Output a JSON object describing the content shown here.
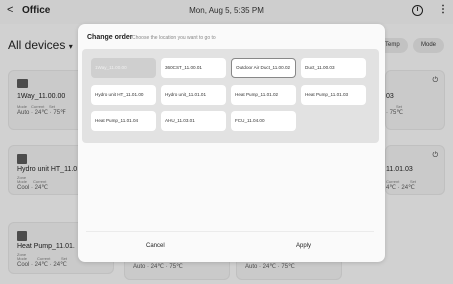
{
  "header": {
    "back_glyph": "<",
    "title": "Office",
    "datetime": "Mon, Aug 5, 5:35 PM",
    "info_glyph": "i",
    "more_glyph": "⋮"
  },
  "page": {
    "title": "All devices",
    "chevron": "▾",
    "temp_button": "Temp",
    "mode_button": "Mode"
  },
  "cards": [
    {
      "name": "1Way_11.00.00",
      "mode_label": "Mode",
      "current_label": "Current",
      "set_label": "Set",
      "values": "Auto · 24℃ · 75℉"
    },
    {
      "name": "Hydro unit HT_11.0",
      "zone_label": "Zone",
      "mode_label": "Mode",
      "current_label": "Current",
      "values": "Cool · 24℃"
    },
    {
      "name": "Heat Pump_11.01.",
      "zone_label": "Zone",
      "mode_label": "Mode",
      "current_label": "Current",
      "set_label": "Set",
      "values": "Cool · 24℃ · 24℃"
    },
    {
      "name": "11.01.03",
      "current_label": "Current",
      "set_label": "Set",
      "values": "4℃ · 24℃"
    },
    {
      "name": "03",
      "set_label": "Set",
      "values": "· 75℃"
    },
    {
      "values": "Auto · 24℃ · 75℃"
    },
    {
      "values": "Auto · 24℃ · 75℃"
    }
  ],
  "dialog": {
    "title": "Change order",
    "hint": "Choose the location you want to go to",
    "options": [
      {
        "label": "1Way_11.00.00",
        "state": "disabled"
      },
      {
        "label": "360CST_11.00.01",
        "state": "normal"
      },
      {
        "label": "Outdoor Air Duct_11.00.02",
        "state": "selected"
      },
      {
        "label": "Duct_11.00.03",
        "state": "normal"
      },
      {
        "label": "Hydro unit HT_11.01.00",
        "state": "normal"
      },
      {
        "label": "Hydro unit_11.01.01",
        "state": "normal"
      },
      {
        "label": "Heat Pump_11.01.02",
        "state": "normal"
      },
      {
        "label": "Heat Pump_11.01.03",
        "state": "normal"
      },
      {
        "label": "Heat Pump_11.01.04",
        "state": "normal"
      },
      {
        "label": "AHU_11.03.01",
        "state": "normal"
      },
      {
        "label": "FCU_11.04.00",
        "state": "normal"
      }
    ],
    "cancel": "Cancel",
    "apply": "Apply"
  },
  "icons": {
    "back": "chevron-left-icon",
    "info": "info-icon",
    "more": "more-vert-icon",
    "power": "power-icon"
  },
  "colors": {
    "dialog_bg": "#fafafa",
    "option_panel": "#e2e2e2",
    "option_disabled": "#cfcfcf"
  }
}
